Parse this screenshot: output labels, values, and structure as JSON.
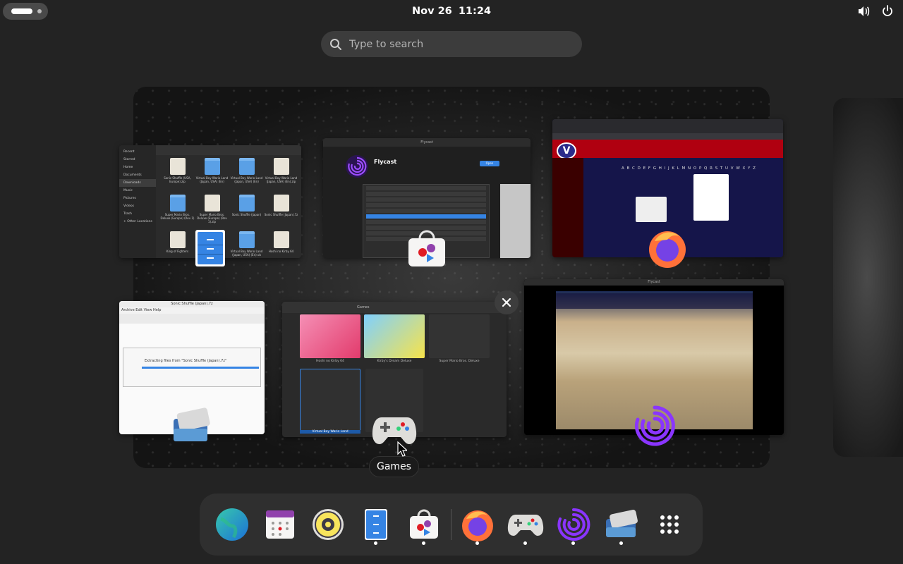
{
  "topbar": {
    "date": "Nov 26",
    "time": "11:24",
    "tray_icons": [
      "volume-icon",
      "power-icon"
    ]
  },
  "search": {
    "placeholder": "Type to search"
  },
  "windows": {
    "files": {
      "sidebar": [
        "Recent",
        "Starred",
        "Home",
        "Documents",
        "Downloads",
        "Music",
        "Pictures",
        "Videos",
        "Trash",
        "+ Other Locations"
      ],
      "items": [
        {
          "label": "Sonic Shuffle (USA, Europe).zip",
          "kind": "doc"
        },
        {
          "label": "Virtual Boy Wario Land (Japan, USA) (En)",
          "kind": "fold"
        },
        {
          "label": "Virtual Boy Wario Land (Japan, USA) (En)",
          "kind": "fold"
        },
        {
          "label": "Virtual Boy Wario Land (Japan, USA) (En).zip",
          "kind": "doc"
        },
        {
          "label": "Super Mario Bros. Deluxe (Europe) (Rev 1)",
          "kind": "fold"
        },
        {
          "label": "Super Mario Bros. Deluxe (Europe) (Rev 1).zip",
          "kind": "doc"
        },
        {
          "label": "Sonic Shuffle (Japan)",
          "kind": "fold"
        },
        {
          "label": "Sonic Shuffle (Japan).7z",
          "kind": "doc"
        },
        {
          "label": "King of Fighters",
          "kind": "doc"
        },
        {
          "label": "",
          "kind": "fold"
        },
        {
          "label": "Virtual Boy Wario Land (Japan, USA) (En).vb",
          "kind": "fold"
        },
        {
          "label": "Hoshi no Kirby 64",
          "kind": "doc"
        }
      ]
    },
    "flycast": {
      "title": "Flycast",
      "app_name": "Flycast",
      "install_label": "Open"
    },
    "firefox": {
      "alphabet": "A B C D E F G H I J K L M N O P Q R S T U V W X Y Z"
    },
    "archive": {
      "title": "Sonic Shuffle (Japan).7z",
      "menu": "Archive  Edit  View  Help",
      "extract_text": "Extracting files from \"Sonic Shuffle (Japan).7z\""
    },
    "games": {
      "header": "Games",
      "tiles": [
        "Hoshi no Kirby 64",
        "Kirby's Dream Deluxe",
        "Super Mario Bros. Deluxe",
        "Virtual Boy Wario Land",
        ""
      ]
    },
    "game_window": {
      "title": "Flycast"
    }
  },
  "tooltip": {
    "label": "Games"
  },
  "dash": {
    "items": [
      {
        "name": "web-browser-icon",
        "running": false
      },
      {
        "name": "calendar-icon",
        "running": false
      },
      {
        "name": "rhythmbox-icon",
        "running": false
      },
      {
        "name": "files-icon",
        "running": true
      },
      {
        "name": "software-icon",
        "running": true
      },
      {
        "name": "firefox-icon",
        "running": true
      },
      {
        "name": "games-icon",
        "running": true
      },
      {
        "name": "flycast-icon",
        "running": true
      },
      {
        "name": "file-roller-icon",
        "running": true
      },
      {
        "name": "app-grid-icon",
        "running": false
      }
    ]
  },
  "colors": {
    "accent": "#3584e4",
    "flycast_purple": "#7a2ee0",
    "firefox_orange": "#ff7139"
  }
}
